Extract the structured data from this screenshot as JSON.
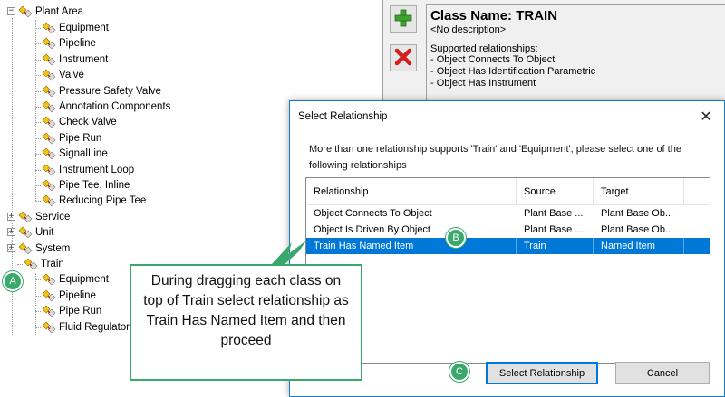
{
  "tree": {
    "root": "Plant Area",
    "children": [
      "Equipment",
      "Pipeline",
      "Instrument",
      "Valve",
      "Pressure Safety Valve",
      "Annotation Components",
      "Check Valve",
      "Pipe Run",
      "SignalLine",
      "Instrument Loop",
      "Pipe Tee, Inline",
      "Reducing Pipe Tee"
    ],
    "collapsed": [
      "Service",
      "Unit",
      "System"
    ],
    "train": "Train",
    "train_children": [
      "Equipment",
      "Pipeline",
      "Pipe Run",
      "Fluid Regulator"
    ],
    "expand_minus": "−",
    "expand_plus": "+"
  },
  "toolbar": {
    "add_icon": "plus-icon",
    "delete_icon": "x-icon"
  },
  "info": {
    "title": "Class Name:  TRAIN",
    "description": "<No description>",
    "supported_label": "Supported relationships:",
    "relationships": [
      " - Object Connects To Object",
      " - Object Has Identification Parametric",
      " - Object Has Instrument"
    ]
  },
  "dialog": {
    "title": "Select Relationship",
    "close": "✕",
    "prompt": "More than one relationship supports 'Train' and 'Equipment'; please select one of the following relationships",
    "columns": [
      "Relationship",
      "Source",
      "Target"
    ],
    "rows": [
      {
        "rel": "Object Connects To Object",
        "source": "Plant Base ...",
        "target": "Plant Base Ob..."
      },
      {
        "rel": "Object Is Driven By Object",
        "source": "Plant Base ...",
        "target": "Plant Base Ob..."
      },
      {
        "rel": "Train Has Named Item",
        "source": "Train",
        "target": "Named Item"
      }
    ],
    "select_button": "Select Relationship",
    "cancel_button": "Cancel"
  },
  "annotations": {
    "badge_a": "A",
    "badge_b": "B",
    "badge_c": "C",
    "callout": "During dragging each class on top of Train select relationship as Train Has Named Item and then proceed",
    "color": "#3aa86b"
  }
}
